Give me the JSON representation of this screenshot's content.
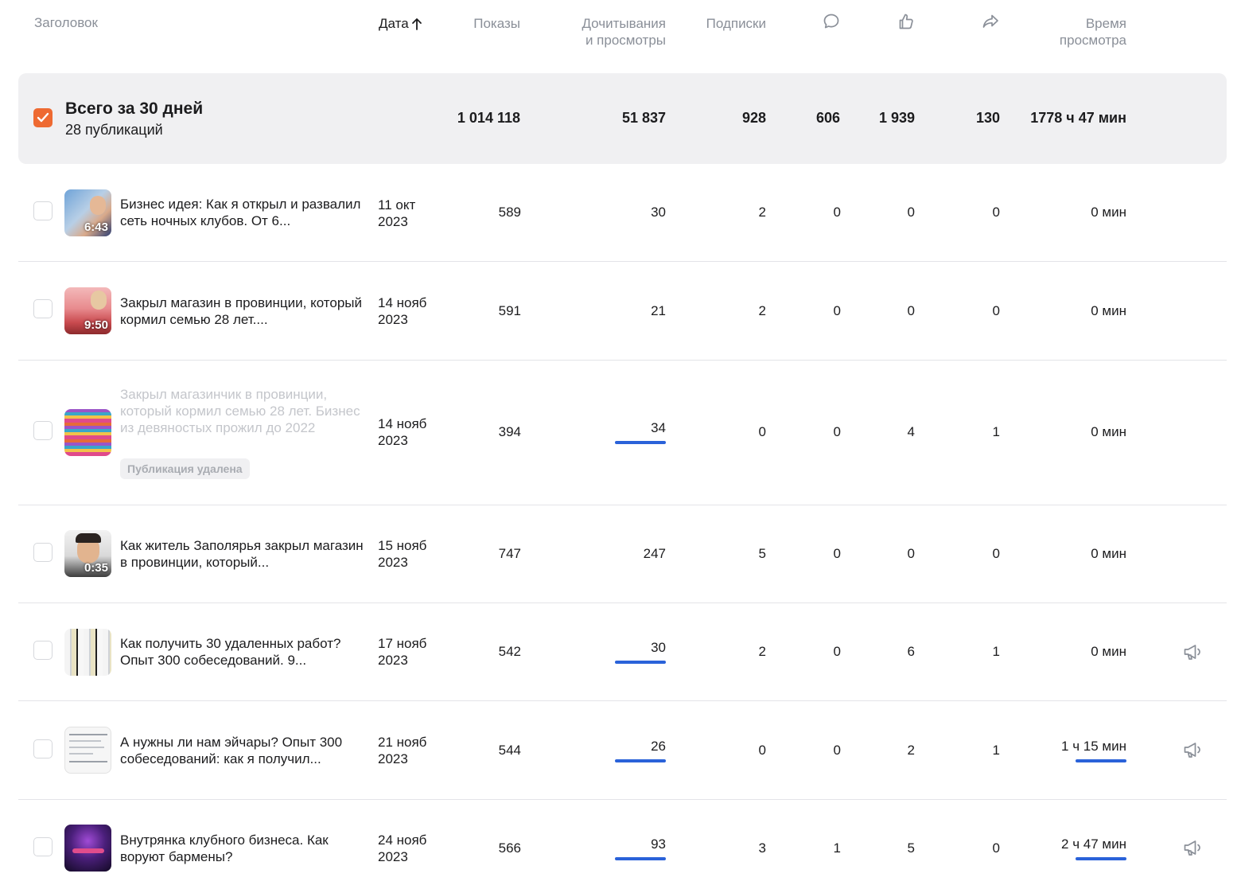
{
  "header": {
    "title_col": "Заголовок",
    "date_col": "Дата",
    "impressions_col": "Показы",
    "reads_col_line1": "Дочитывания",
    "reads_col_line2": "и просмотры",
    "subs_col": "Подписки",
    "time_col_line1": "Время",
    "time_col_line2": "просмотра",
    "icons": [
      "comment-icon",
      "like-icon",
      "share-icon"
    ],
    "sort_icon": "arrow-up-icon"
  },
  "summary": {
    "title": "Всего за 30 дней",
    "subtitle": "28 публикаций",
    "impressions": "1 014 118",
    "reads": "51 837",
    "subs": "928",
    "comments": "606",
    "likes": "1 939",
    "shares": "130",
    "time": "1778 ч 47 мин",
    "checked": true
  },
  "colors": {
    "accent": "#ee6a32",
    "bar": "#2a62d9",
    "muted": "#8a8f98"
  },
  "rows": [
    {
      "title": "Бизнес идея: Как я открыл и развалил сеть ночных клубов. От 6...",
      "date_line1": "11 окт",
      "date_line2": "2023",
      "duration": "6:43",
      "impressions": "589",
      "reads": "30",
      "subs": "2",
      "comments": "0",
      "likes": "0",
      "shares": "0",
      "time": "0 мин",
      "reads_bar": false,
      "time_bar": false,
      "promo": false,
      "deleted": false
    },
    {
      "title": "Закрыл магазин в провинции, который кормил семью 28 лет....",
      "date_line1": "14 нояб",
      "date_line2": "2023",
      "duration": "9:50",
      "impressions": "591",
      "reads": "21",
      "subs": "2",
      "comments": "0",
      "likes": "0",
      "shares": "0",
      "time": "0 мин",
      "reads_bar": false,
      "time_bar": false,
      "promo": false,
      "deleted": false
    },
    {
      "title": "Закрыл магазинчик в провинции, который кормил семью 28 лет. Бизнес из девяностых прожил до 2022",
      "badge": "Публикация удалена",
      "date_line1": "14 нояб",
      "date_line2": "2023",
      "duration": "",
      "impressions": "394",
      "reads": "34",
      "subs": "0",
      "comments": "0",
      "likes": "4",
      "shares": "1",
      "time": "0 мин",
      "reads_bar": true,
      "time_bar": false,
      "promo": false,
      "deleted": true
    },
    {
      "title": "Как житель Заполярья закрыл магазин в провинции, который...",
      "date_line1": "15 нояб",
      "date_line2": "2023",
      "duration": "0:35",
      "impressions": "747",
      "reads": "247",
      "subs": "5",
      "comments": "0",
      "likes": "0",
      "shares": "0",
      "time": "0 мин",
      "reads_bar": false,
      "time_bar": false,
      "promo": false,
      "deleted": false
    },
    {
      "title": "Как получить 30 удаленных работ? Опыт 300 собеседований. 9...",
      "date_line1": "17 нояб",
      "date_line2": "2023",
      "duration": "",
      "impressions": "542",
      "reads": "30",
      "subs": "2",
      "comments": "0",
      "likes": "6",
      "shares": "1",
      "time": "0 мин",
      "reads_bar": true,
      "time_bar": false,
      "promo": true,
      "deleted": false
    },
    {
      "title": "А нужны ли нам эйчары? Опыт 300 собеседований: как я получил...",
      "date_line1": "21 нояб",
      "date_line2": "2023",
      "duration": "",
      "impressions": "544",
      "reads": "26",
      "subs": "0",
      "comments": "0",
      "likes": "2",
      "shares": "1",
      "time": "1 ч 15 мин",
      "reads_bar": true,
      "time_bar": true,
      "promo": true,
      "deleted": false
    },
    {
      "title": "Внутрянка клубного бизнеса. Как воруют бармены?",
      "date_line1": "24 нояб",
      "date_line2": "2023",
      "duration": "",
      "impressions": "566",
      "reads": "93",
      "subs": "3",
      "comments": "1",
      "likes": "5",
      "shares": "0",
      "time": "2 ч 47 мин",
      "reads_bar": true,
      "time_bar": true,
      "promo": true,
      "deleted": false
    }
  ]
}
